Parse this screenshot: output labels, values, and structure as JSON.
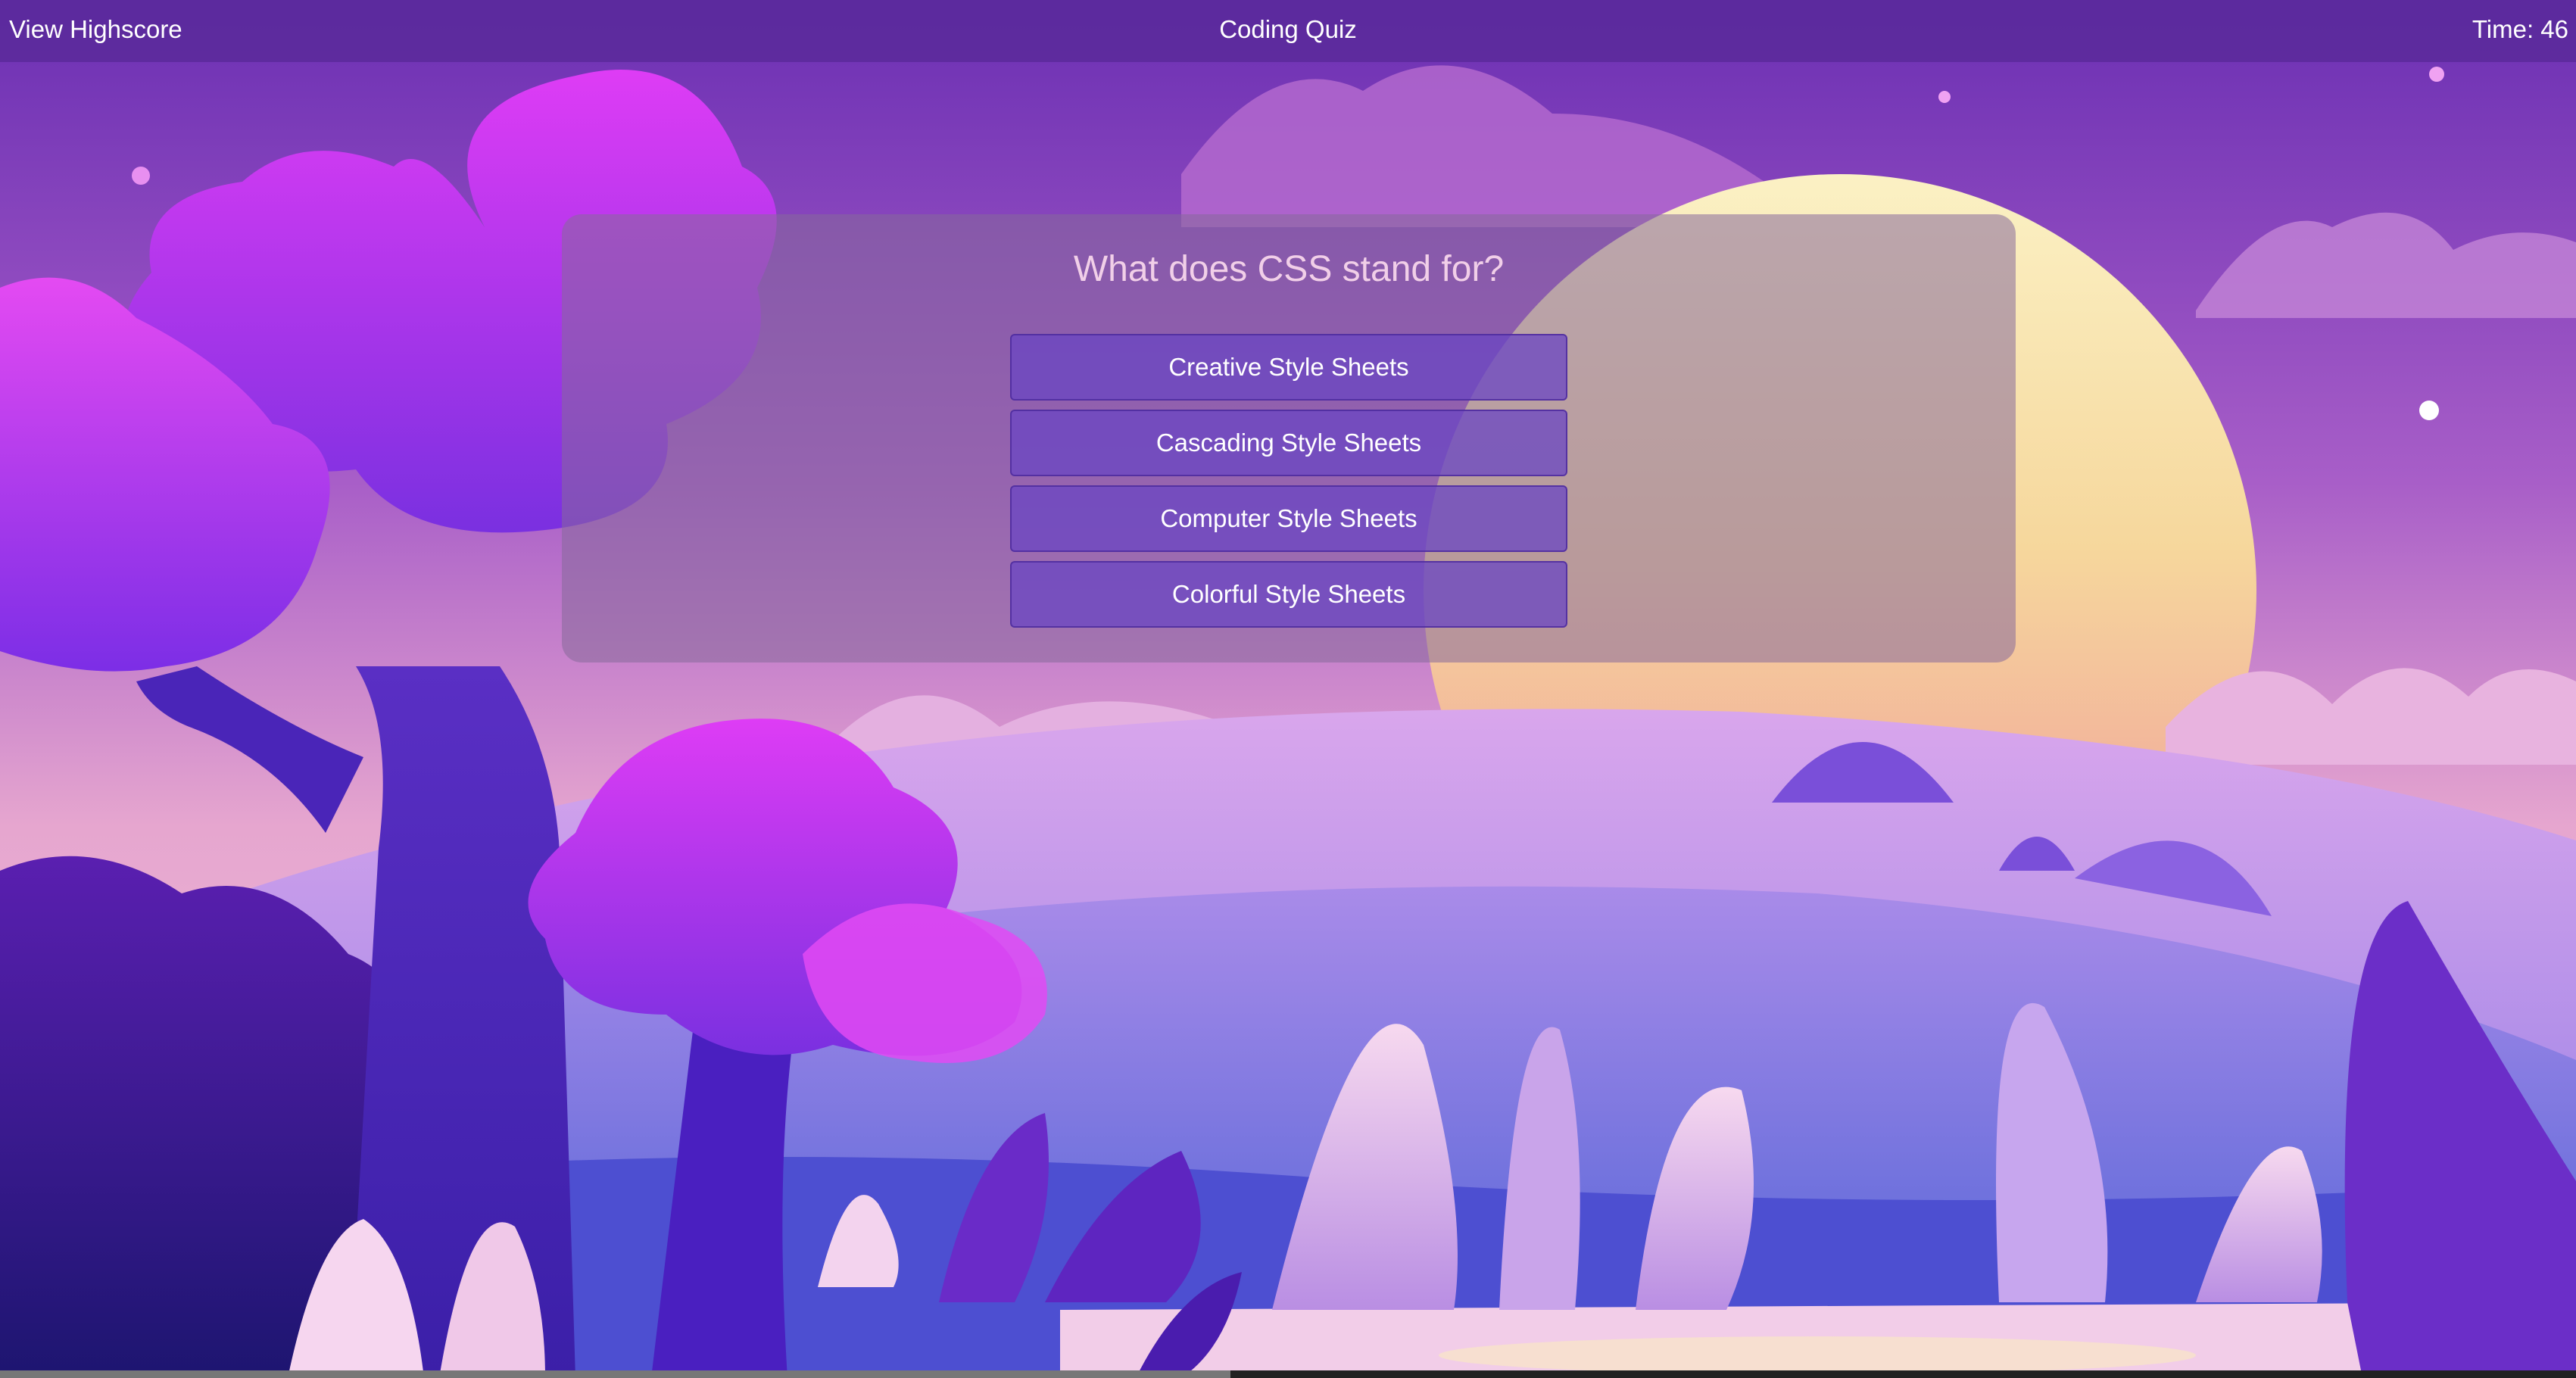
{
  "header": {
    "highscore_link": "View Highscore",
    "title": "Coding Quiz",
    "timer": "Time: 46"
  },
  "quiz": {
    "question": "What does CSS stand for?",
    "answers": [
      "Creative Style Sheets",
      "Cascading Style Sheets",
      "Computer Style Sheets",
      "Colorful Style Sheets"
    ]
  },
  "colors": {
    "header_bg": "#5a2a96",
    "card_bg": "#8a6a9c",
    "question_text": "#f1cfe8",
    "button_bg": "#6a46c3",
    "button_text": "#ffffff"
  },
  "background": {
    "illustration": "purple fantasy landscape with trees, hills, plants and setting sun"
  }
}
